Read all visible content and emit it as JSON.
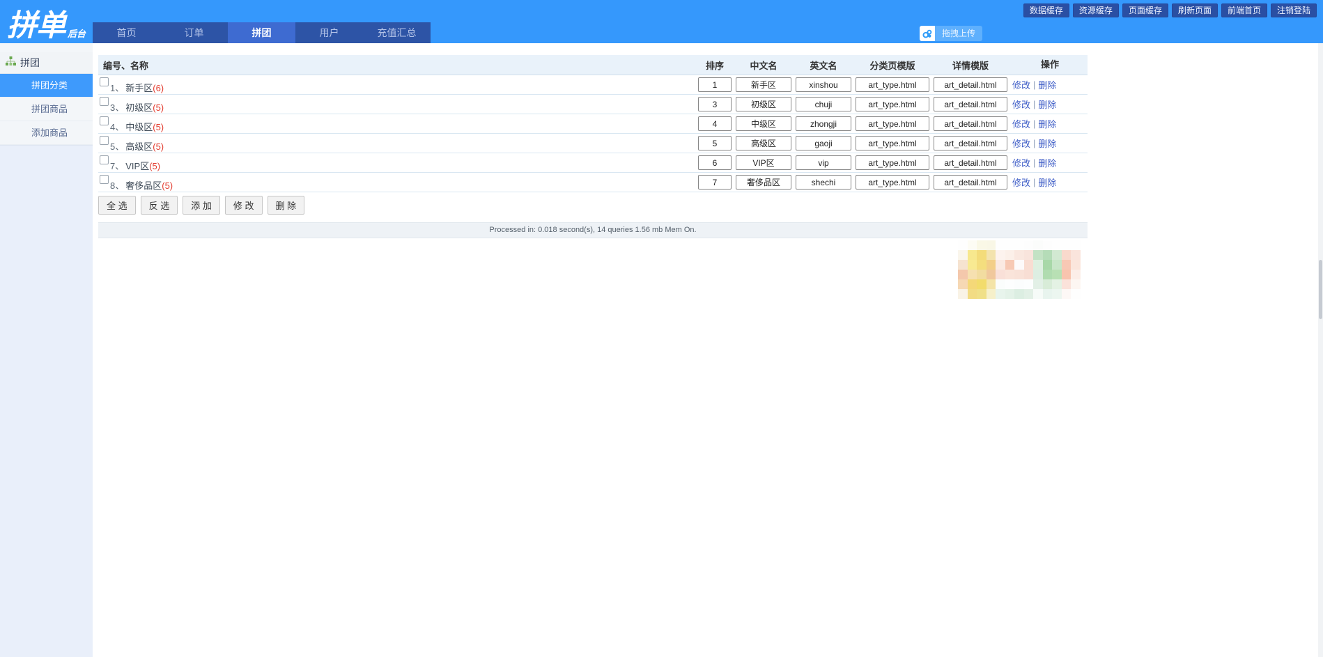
{
  "header": {
    "logo_main": "拼单",
    "logo_sub": "后台",
    "cache_buttons": [
      "数据缓存",
      "资源缓存",
      "页面缓存",
      "刷新页面",
      "前端首页",
      "注销登陆"
    ],
    "nav_tabs": [
      {
        "label": "首页",
        "active": false
      },
      {
        "label": "订单",
        "active": false
      },
      {
        "label": "拼团",
        "active": true
      },
      {
        "label": "用户",
        "active": false
      },
      {
        "label": "充值汇总",
        "active": false
      }
    ],
    "upload_label": "拖拽上传"
  },
  "sidebar": {
    "group_label": "拼团",
    "items": [
      {
        "label": "拼团分类",
        "active": true
      },
      {
        "label": "拼团商品",
        "active": false
      },
      {
        "label": "添加商品",
        "active": false
      }
    ]
  },
  "table": {
    "columns": {
      "name": "编号、名称",
      "sort": "排序",
      "cn": "中文名",
      "en": "英文名",
      "cat_tpl": "分类页模版",
      "detail_tpl": "详情模版",
      "ops": "操作"
    },
    "ops": {
      "edit": "修改",
      "sep": "|",
      "delete": "删除"
    },
    "rows": [
      {
        "label_no": "1、",
        "label_name": "新手区",
        "label_count": "(6)",
        "sort": "1",
        "cn": "新手区",
        "en": "xinshou",
        "cat_tpl": "art_type.html",
        "detail_tpl": "art_detail.html"
      },
      {
        "label_no": "3、",
        "label_name": "初级区",
        "label_count": "(5)",
        "sort": "3",
        "cn": "初级区",
        "en": "chuji",
        "cat_tpl": "art_type.html",
        "detail_tpl": "art_detail.html"
      },
      {
        "label_no": "4、",
        "label_name": "中级区",
        "label_count": "(5)",
        "sort": "4",
        "cn": "中级区",
        "en": "zhongji",
        "cat_tpl": "art_type.html",
        "detail_tpl": "art_detail.html"
      },
      {
        "label_no": "5、",
        "label_name": "高级区",
        "label_count": "(5)",
        "sort": "5",
        "cn": "高级区",
        "en": "gaoji",
        "cat_tpl": "art_type.html",
        "detail_tpl": "art_detail.html"
      },
      {
        "label_no": "7、",
        "label_name": "VIP区",
        "label_count": "(5)",
        "sort": "6",
        "cn": "VIP区",
        "en": "vip",
        "cat_tpl": "art_type.html",
        "detail_tpl": "art_detail.html"
      },
      {
        "label_no": "8、",
        "label_name": "奢侈品区",
        "label_count": "(5)",
        "sort": "7",
        "cn": "奢侈品区",
        "en": "shechi",
        "cat_tpl": "art_type.html",
        "detail_tpl": "art_detail.html"
      }
    ]
  },
  "actions": [
    "全 选",
    "反 选",
    "添 加",
    "修 改",
    "删 除"
  ],
  "status": "Processed in: 0.018 second(s), 14 queries 1.56 mb Mem On.",
  "watermark": {
    "rows": [
      [
        "#fefefe",
        "#fdfcf4",
        "#faf8e6",
        "#f9f7e6",
        "#fefefe",
        "#fefefe",
        "#fefefe",
        "#fdfdfd",
        "#fbfcfb",
        "#fdfdfd",
        "#fefefe",
        "#fefefe",
        "#fefefe"
      ],
      [
        "#faf6ec",
        "#f7e88e",
        "#f3dc7a",
        "#f3e3ae",
        "#fdf3ee",
        "#fcf0e9",
        "#fae8e0",
        "#f9e4dc",
        "#c3e2c4",
        "#b5dcb8",
        "#d2e9d2",
        "#f9d9cc",
        "#fae4dc"
      ],
      [
        "#f6e3d0",
        "#f8ea92",
        "#f4de7e",
        "#f3cf88",
        "#fbeae2",
        "#f7c9b4",
        "#fdfafa",
        "#f9ddd2",
        "#def0e0",
        "#a8d8a8",
        "#c8e6c8",
        "#f8c8b4",
        "#fbe6dc"
      ],
      [
        "#f4c8ac",
        "#f6e0b0",
        "#f2dca0",
        "#f0c89c",
        "#f9e0d8",
        "#fae4da",
        "#f9e2d8",
        "#f8ded4",
        "#ddeee2",
        "#b0dcb0",
        "#b8e0b4",
        "#f8c4ae",
        "#fceee8"
      ],
      [
        "#f6d8b4",
        "#f4d878",
        "#f2dc6c",
        "#f4e4a8",
        "#fbfdfc",
        "#fdfefe",
        "#fbfdfd",
        "#fcfefe",
        "#e2f0e6",
        "#d8ecd8",
        "#e4f2e4",
        "#fbe2da",
        "#fdf6f2"
      ],
      [
        "#f9f3e6",
        "#f2dc84",
        "#f0e088",
        "#f6f0ca",
        "#e8f4ec",
        "#e4f2e8",
        "#dceee2",
        "#e2f0e6",
        "#f6fbf8",
        "#e8f4ee",
        "#ecf6f0",
        "#fdf8f6",
        "#fefefe"
      ]
    ]
  },
  "colors": {
    "header_blue": "#3598fc",
    "nav_dark": "#2d54a6",
    "nav_active": "#3e6bd1",
    "cache_button": "#2a4fa3",
    "sidebar_active": "#3e9afc",
    "link_blue": "#3f5ec7",
    "count_red": "#e23b2e",
    "table_header_bg": "#e9f2fa"
  }
}
